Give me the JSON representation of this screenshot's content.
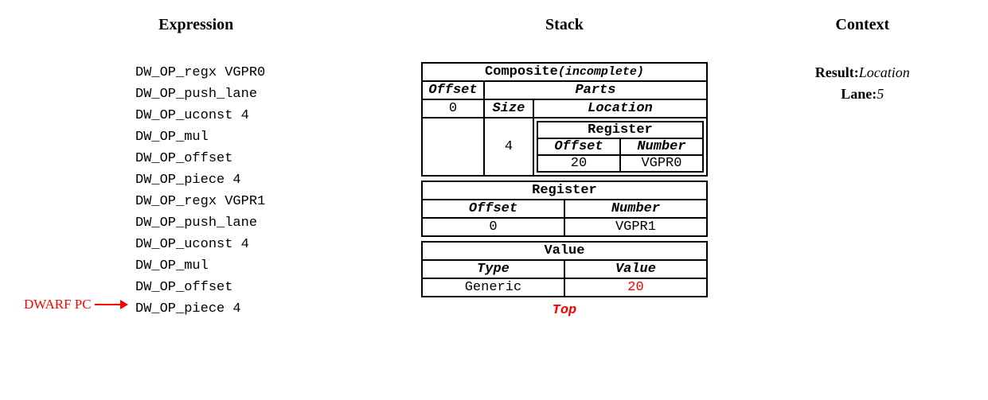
{
  "headings": {
    "expression": "Expression",
    "stack": "Stack",
    "context": "Context"
  },
  "pc_label": "DWARF PC",
  "instructions": [
    "DW_OP_regx VGPR0",
    "DW_OP_push_lane",
    "DW_OP_uconst 4",
    "DW_OP_mul",
    "DW_OP_offset",
    "DW_OP_piece 4",
    "DW_OP_regx VGPR1",
    "DW_OP_push_lane",
    "DW_OP_uconst 4",
    "DW_OP_mul",
    "DW_OP_offset",
    "DW_OP_piece 4"
  ],
  "stack": {
    "composite": {
      "title": "Composite",
      "suffix": "(incomplete)",
      "offset_header": "Offset",
      "offset_value": "0",
      "parts_header": "Parts",
      "size_header": "Size",
      "size_value": "4",
      "location_header": "Location",
      "inner_register": {
        "title": "Register",
        "offset_header": "Offset",
        "number_header": "Number",
        "offset_value": "20",
        "number_value": "VGPR0"
      }
    },
    "register": {
      "title": "Register",
      "offset_header": "Offset",
      "number_header": "Number",
      "offset_value": "0",
      "number_value": "VGPR1"
    },
    "value": {
      "title": "Value",
      "type_header": "Type",
      "value_header": "Value",
      "type_value": "Generic",
      "value_value": "20"
    },
    "top_label": "Top"
  },
  "context": {
    "result_label": "Result:",
    "result_value": "Location",
    "lane_label": "Lane:",
    "lane_value": "5"
  }
}
